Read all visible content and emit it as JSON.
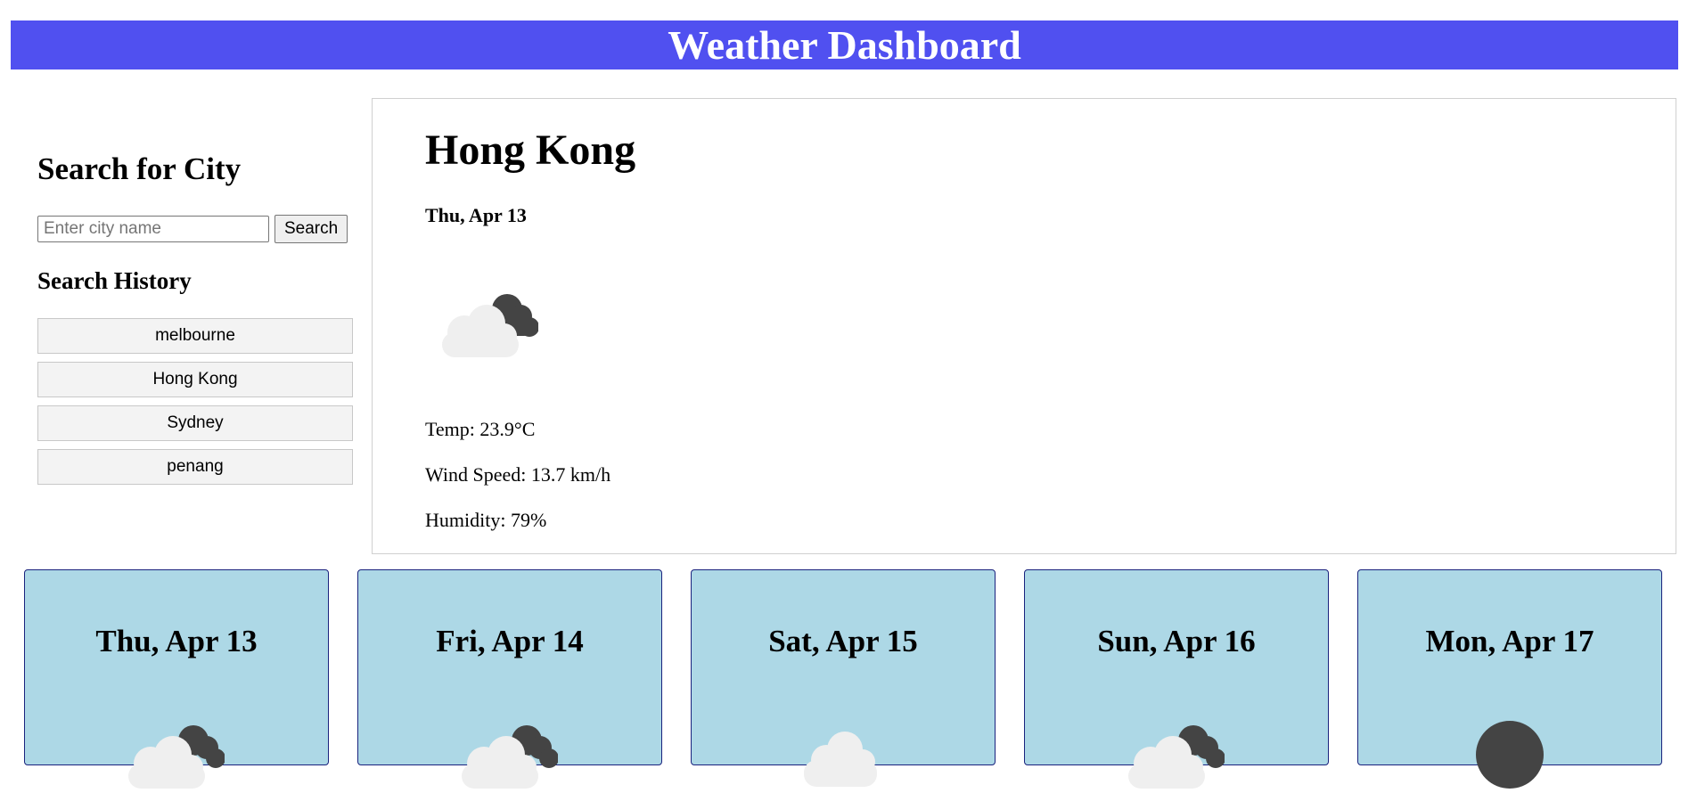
{
  "header": {
    "title": "Weather Dashboard",
    "background_color": "#5050f0"
  },
  "sidebar": {
    "search_heading": "Search for City",
    "search_placeholder": "Enter city name",
    "search_value": "",
    "search_button_label": "Search",
    "history_heading": "Search History",
    "history": [
      "melbourne",
      "Hong Kong",
      "Sydney",
      "penang"
    ]
  },
  "current": {
    "city": "Hong Kong",
    "date": "Thu, Apr 13",
    "icon": "broken-clouds-icon",
    "temp": "Temp: 23.9°C",
    "wind": "Wind Speed: 13.7 km/h",
    "humidity": "Humidity: 79%"
  },
  "forecast": [
    {
      "date": "Thu, Apr 13",
      "icon": "broken-clouds-icon"
    },
    {
      "date": "Fri, Apr 14",
      "icon": "broken-clouds-icon"
    },
    {
      "date": "Sat, Apr 15",
      "icon": "few-clouds-icon"
    },
    {
      "date": "Sun, Apr 16",
      "icon": "broken-clouds-icon"
    },
    {
      "date": "Mon, Apr 17",
      "icon": "overcast-clouds-icon"
    }
  ],
  "colors": {
    "forecast_card_bg": "#add8e6",
    "forecast_card_border": "#1a237e"
  }
}
